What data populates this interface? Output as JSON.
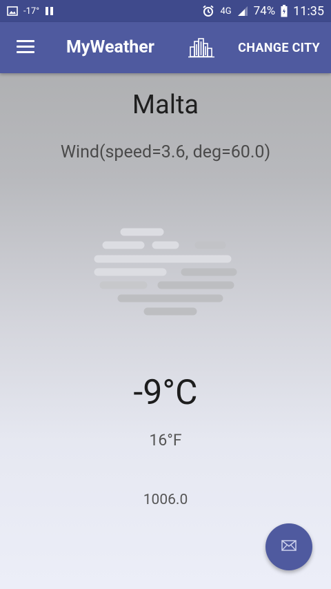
{
  "status_bar": {
    "temperature": "-17°",
    "network": "4G",
    "battery": "74%",
    "time": "11:35",
    "icons": [
      "image-icon",
      "pause-icon",
      "alarm-icon",
      "signal-icon",
      "battery-icon"
    ]
  },
  "app_bar": {
    "title": "MyWeather",
    "action_label": "CHANGE CITY",
    "icons": [
      "menu-icon",
      "city-chart-icon"
    ]
  },
  "weather": {
    "city": "Malta",
    "wind": "Wind(speed=3.6, deg=60.0)",
    "icon": "fog-icon",
    "temp_c": "-9°C",
    "temp_f": "16°F",
    "pressure": "1006.0"
  },
  "fab": {
    "icon": "mail-icon"
  },
  "colors": {
    "status_bar": "#3f4a8c",
    "app_bar": "#4f5a9f",
    "fab": "#4f5a9f"
  }
}
